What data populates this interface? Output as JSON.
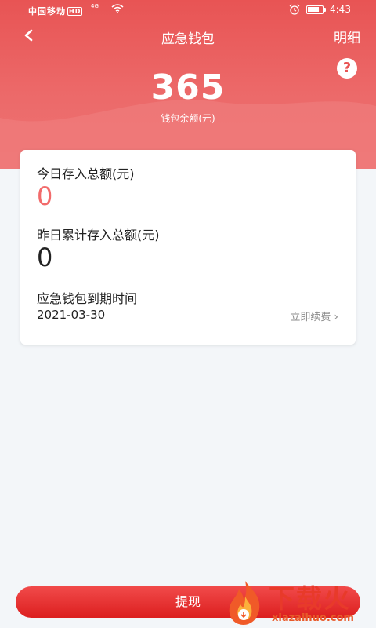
{
  "status_bar": {
    "carrier": "中国移动",
    "hd": "HD",
    "signal": "4G",
    "time": "4:43",
    "battery_level": 0.8
  },
  "nav": {
    "title": "应急钱包",
    "detail_link": "明细",
    "help": "?"
  },
  "wallet": {
    "balance": "365",
    "balance_label": "钱包余额(元)"
  },
  "card": {
    "today_label": "今日存入总额(元)",
    "today_value": "0",
    "yesterday_label": "昨日累计存入总额(元)",
    "yesterday_value": "0",
    "expire_label": "应急钱包到期时间",
    "expire_date": "2021-03-30",
    "renew_label": "立即续费"
  },
  "footer": {
    "withdraw_label": "提现"
  },
  "watermark": {
    "text": "下载火",
    "url": "xiazaihuo.com"
  },
  "colors": {
    "header_red": "#e85454",
    "accent_value": "#f26b6b",
    "button_red": "#e62e2e"
  }
}
